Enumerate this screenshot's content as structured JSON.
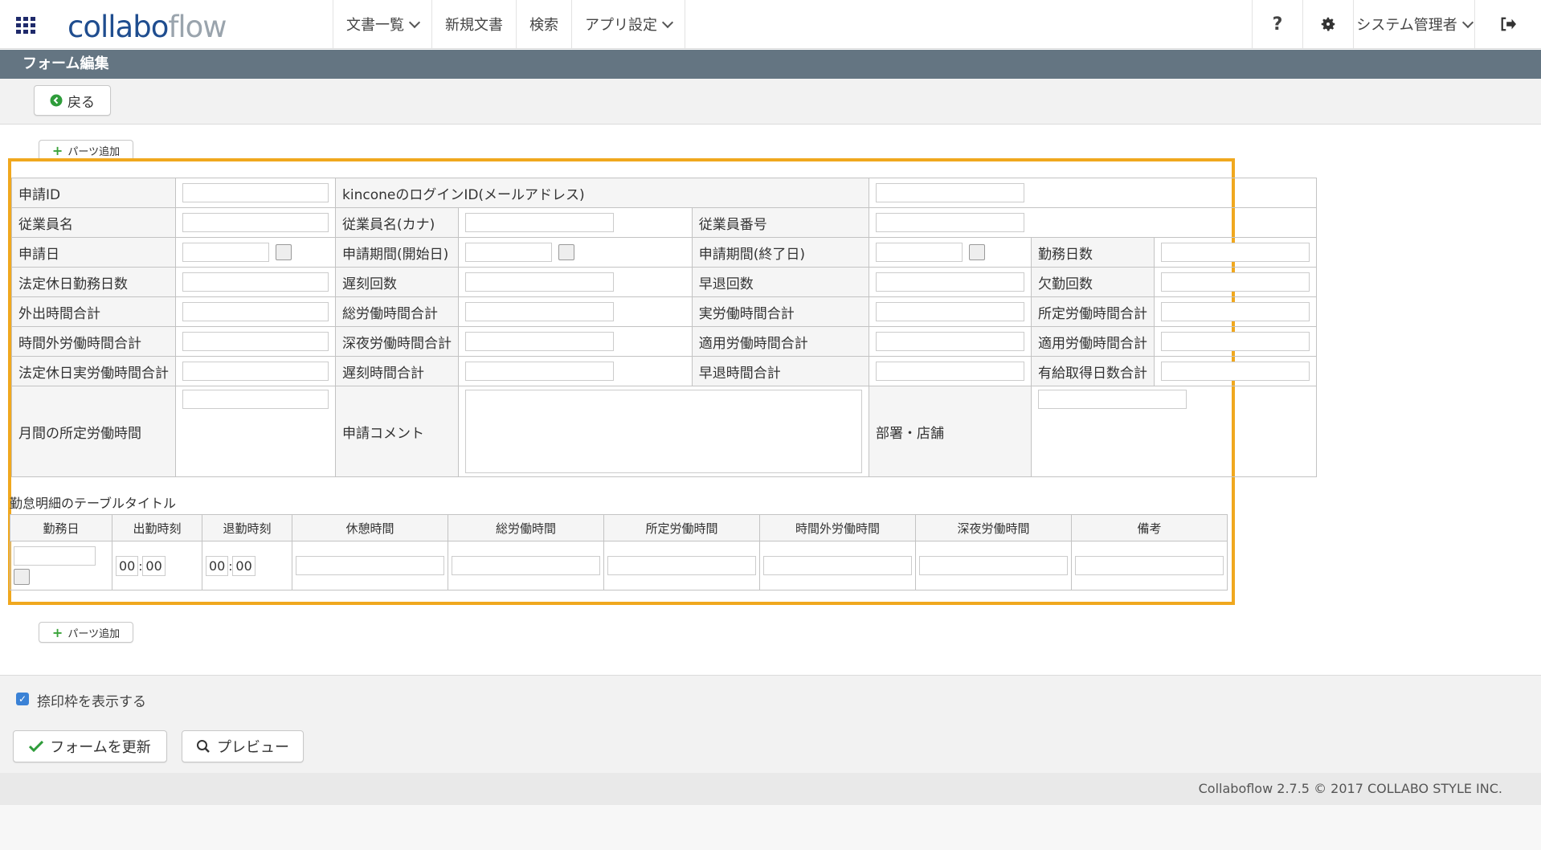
{
  "app": {
    "logo_text_a": "collabo",
    "logo_text_b": "flow"
  },
  "nav": {
    "items": [
      "文書一覧",
      "新規文書",
      "検索",
      "アプリ設定"
    ],
    "help": "?",
    "user": "システム管理者"
  },
  "page": {
    "title": "フォーム編集",
    "back_label": "戻る",
    "add_parts_label": "パーツ追加"
  },
  "form": {
    "labels": {
      "app_id": "申請ID",
      "login_id": "kinconeのログインID(メールアドレス)",
      "employee_name": "従業員名",
      "employee_kana": "従業員名(カナ)",
      "employee_no": "従業員番号",
      "apply_date": "申請日",
      "period_start": "申請期間(開始日)",
      "period_end": "申請期間(終了日)",
      "work_days": "勤務日数",
      "holiday_work_days": "法定休日勤務日数",
      "late_count": "遅刻回数",
      "early_count": "早退回数",
      "absent_count": "欠勤回数",
      "out_time_total": "外出時間合計",
      "total_work_time": "総労働時間合計",
      "actual_work_time": "実労働時間合計",
      "scheduled_work_time": "所定労働時間合計",
      "overtime_total": "時間外労働時間合計",
      "night_total": "深夜労働時間合計",
      "applied_work_total_1": "適用労働時間合計",
      "applied_work_total_2": "適用労働時間合計",
      "holiday_actual_total": "法定休日実労働時間合計",
      "late_time_total": "遅刻時間合計",
      "early_time_total": "早退時間合計",
      "paid_leave_days": "有給取得日数合計",
      "monthly_scheduled": "月間の所定労働時間",
      "comment": "申請コメント",
      "department": "部署・店舗"
    }
  },
  "detail": {
    "title": "勤怠明細のテーブルタイトル",
    "headers": [
      "勤務日",
      "出勤時刻",
      "退勤時刻",
      "休憩時間",
      "総労働時間",
      "所定労働時間",
      "時間外労働時間",
      "深夜労働時間",
      "備考"
    ],
    "time_hh": "00",
    "time_mm": "00",
    "time_sep": ":"
  },
  "footer": {
    "show_stamp_label": "捺印枠を表示する",
    "update_label": "フォームを更新",
    "preview_label": "プレビュー",
    "copyright": "Collaboflow 2.7.5 © 2017 COLLABO STYLE INC."
  }
}
